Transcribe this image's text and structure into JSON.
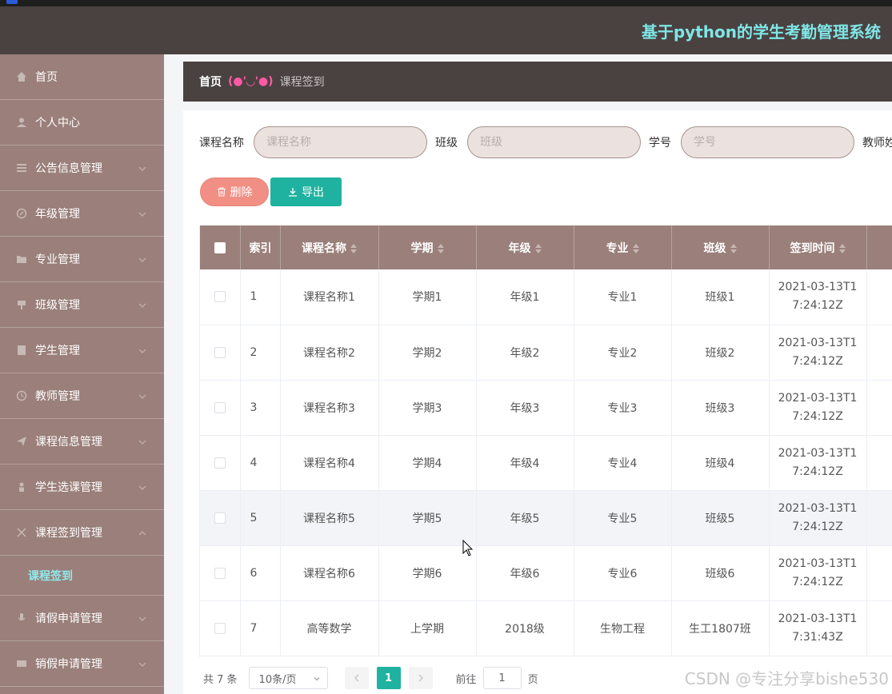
{
  "app": {
    "title": "基于python的学生考勤管理系统"
  },
  "sidebar": {
    "items": [
      {
        "label": "首页",
        "icon": "home-icon"
      },
      {
        "label": "个人中心",
        "icon": "user-icon"
      },
      {
        "label": "公告信息管理",
        "icon": "list-icon"
      },
      {
        "label": "年级管理",
        "icon": "edit-icon"
      },
      {
        "label": "专业管理",
        "icon": "folder-icon"
      },
      {
        "label": "班级管理",
        "icon": "flag-icon"
      },
      {
        "label": "学生管理",
        "icon": "doc-icon"
      },
      {
        "label": "教师管理",
        "icon": "clock-icon"
      },
      {
        "label": "课程信息管理",
        "icon": "send-icon"
      },
      {
        "label": "学生选课管理",
        "icon": "person-icon"
      },
      {
        "label": "课程签到管理",
        "icon": "opened-icon"
      },
      {
        "label": "请假申请管理",
        "icon": "mic-icon"
      },
      {
        "label": "销假申请管理",
        "icon": "card-icon"
      }
    ],
    "active_sub": "课程签到"
  },
  "breadcrumb": {
    "home": "首页",
    "emoticon": "(●'◡'●)",
    "current": "课程签到"
  },
  "search": {
    "fields": [
      {
        "label": "课程名称",
        "placeholder": "课程名称"
      },
      {
        "label": "班级",
        "placeholder": "班级"
      },
      {
        "label": "学号",
        "placeholder": "学号"
      },
      {
        "label": "教师姓名",
        "placeholder": ""
      }
    ]
  },
  "toolbar": {
    "delete_label": "删除",
    "export_label": "导出"
  },
  "table": {
    "headers": [
      "索引",
      "课程名称",
      "学期",
      "年级",
      "专业",
      "班级",
      "签到时间"
    ],
    "rows": [
      {
        "index": "1",
        "course": "课程名称1",
        "term": "学期1",
        "grade": "年级1",
        "major": "专业1",
        "class": "班级1",
        "time1": "2021-03-13T1",
        "time2": "7:24:12Z"
      },
      {
        "index": "2",
        "course": "课程名称2",
        "term": "学期2",
        "grade": "年级2",
        "major": "专业2",
        "class": "班级2",
        "time1": "2021-03-13T1",
        "time2": "7:24:12Z"
      },
      {
        "index": "3",
        "course": "课程名称3",
        "term": "学期3",
        "grade": "年级3",
        "major": "专业3",
        "class": "班级3",
        "time1": "2021-03-13T1",
        "time2": "7:24:12Z"
      },
      {
        "index": "4",
        "course": "课程名称4",
        "term": "学期4",
        "grade": "年级4",
        "major": "专业4",
        "class": "班级4",
        "time1": "2021-03-13T1",
        "time2": "7:24:12Z"
      },
      {
        "index": "5",
        "course": "课程名称5",
        "term": "学期5",
        "grade": "年级5",
        "major": "专业5",
        "class": "班级5",
        "time1": "2021-03-13T1",
        "time2": "7:24:12Z"
      },
      {
        "index": "6",
        "course": "课程名称6",
        "term": "学期6",
        "grade": "年级6",
        "major": "专业6",
        "class": "班级6",
        "time1": "2021-03-13T1",
        "time2": "7:24:12Z"
      },
      {
        "index": "7",
        "course": "高等数学",
        "term": "上学期",
        "grade": "2018级",
        "major": "生物工程",
        "class": "生工1807班",
        "time1": "2021-03-13T1",
        "time2": "7:31:43Z"
      }
    ]
  },
  "pagination": {
    "total": "共 7 条",
    "page_size": "10条/页",
    "current_page": "1",
    "goto_label": "前往",
    "goto_value": "1",
    "page_unit": "页"
  },
  "watermark": "CSDN @专注分享bishe530",
  "colors": {
    "header": "#4a4241",
    "sidebar": "#9a7f7a",
    "accent": "#20b2a0",
    "delete": "#f28f84",
    "title": "#7fe6e6"
  }
}
